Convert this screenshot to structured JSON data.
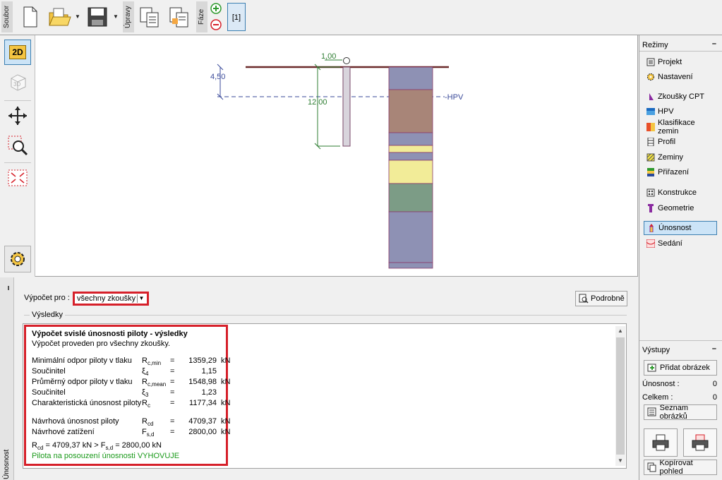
{
  "toolbar": {
    "file_label": "Soubor",
    "edit_label": "Úpravy",
    "phase_label": "Fáze",
    "phase_current": "[1]"
  },
  "left_tools": {
    "view_2d": "2D",
    "view_3d": "3D"
  },
  "canvas": {
    "dim_top": "1,00",
    "dim_left": "4,50",
    "dim_length": "12,00",
    "hpv_label": "HPV",
    "colors": {
      "surface_line": "#6b2a2a",
      "dimension": "#2e7d32",
      "dimension_blue": "#3a4a9a",
      "hpv_line": "#3a4a9a"
    },
    "layers": [
      {
        "color": "#8e91b4"
      },
      {
        "color": "#a88578"
      },
      {
        "color": "#8e91b4"
      },
      {
        "color": "#f2ec98"
      },
      {
        "color": "#8e91b4"
      },
      {
        "color": "#f2ec98"
      },
      {
        "color": "#7c9c86"
      },
      {
        "color": "#8e91b4"
      }
    ]
  },
  "modes": {
    "title": "Režimy",
    "items": [
      {
        "label": "Projekt",
        "icon": "document-icon"
      },
      {
        "label": "Nastavení",
        "icon": "gear-icon"
      },
      {
        "label": "Zkoušky CPT",
        "icon": "cpt-icon"
      },
      {
        "label": "HPV",
        "icon": "water-table-icon"
      },
      {
        "label": "Klasifikace zemin",
        "icon": "soil-classification-icon"
      },
      {
        "label": "Profil",
        "icon": "profile-icon"
      },
      {
        "label": "Zeminy",
        "icon": "soils-icon"
      },
      {
        "label": "Přiřazení",
        "icon": "assign-icon"
      },
      {
        "label": "Konstrukce",
        "icon": "construction-icon"
      },
      {
        "label": "Geometrie",
        "icon": "pile-geometry-icon"
      },
      {
        "label": "Únosnost",
        "icon": "bearing-capacity-icon"
      },
      {
        "label": "Sedání",
        "icon": "settlement-icon"
      }
    ],
    "active": "Únosnost"
  },
  "outputs": {
    "title": "Výstupy",
    "add_picture": "Přidat obrázek",
    "bearing_label": "Únosnost :",
    "bearing_count": "0",
    "total_label": "Celkem :",
    "total_count": "0",
    "picture_list": "Seznam obrázků",
    "copy_view": "Kopírovat pohled"
  },
  "bottom": {
    "tab_label": "Únosnost",
    "calc_for_label": "Výpočet pro :",
    "calc_for_value": "všechny zkoušky",
    "details_button": "Podrobně",
    "results_label": "Výsledky",
    "results": {
      "title": "Výpočet svislé únosnosti piloty - výsledky",
      "subtitle": "Výpočet proveden pro všechny zkoušky.",
      "rows": [
        {
          "label": "Minimální odpor piloty v tlaku",
          "sym": "R",
          "sub": "c,min",
          "eq": "=",
          "value": "1359,29",
          "unit": "kN"
        },
        {
          "label": "Součinitel",
          "sym": "ξ",
          "sub": "4",
          "eq": "=",
          "value": "1,15",
          "unit": ""
        },
        {
          "label": "Průměrný odpor piloty v tlaku",
          "sym": "R",
          "sub": "c,mean",
          "eq": "=",
          "value": "1548,98",
          "unit": "kN"
        },
        {
          "label": "Součinitel",
          "sym": "ξ",
          "sub": "3",
          "eq": "=",
          "value": "1,23",
          "unit": ""
        },
        {
          "label": "Charakteristická únosnost piloty",
          "sym": "R",
          "sub": "c",
          "eq": "=",
          "value": "1177,34",
          "unit": "kN"
        },
        {
          "label": "Návrhová únosnost piloty",
          "sym": "R",
          "sub": "cd",
          "eq": "=",
          "value": "4709,37",
          "unit": "kN"
        },
        {
          "label": "Návrhové zatížení",
          "sym": "F",
          "sub": "s,d",
          "eq": "=",
          "value": "2800,00",
          "unit": "kN"
        }
      ],
      "comparison": {
        "r_sym": "R",
        "r_sub": "cd",
        "r_val": " = 4709,37 kN > F",
        "f_sub": "s,d",
        "f_val": " = 2800,00 kN"
      },
      "verdict": "Pilota na posouzení únosnosti VYHOVUJE",
      "verdict_color": "#1a9a1a"
    }
  }
}
